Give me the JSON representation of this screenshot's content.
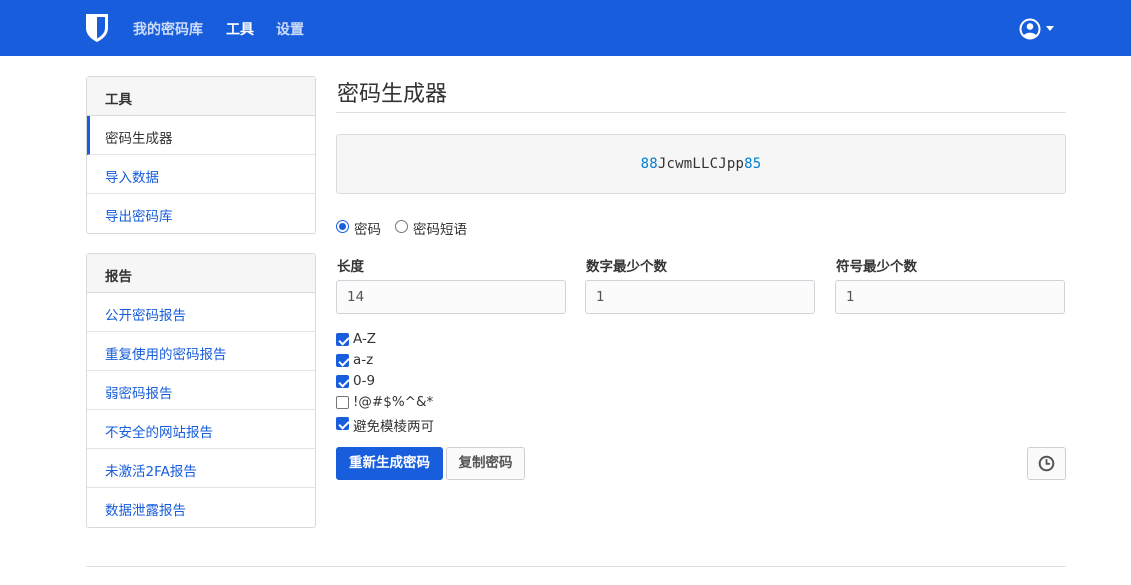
{
  "nav": {
    "links": [
      {
        "label": "我的密码库",
        "active": false
      },
      {
        "label": "工具",
        "active": true
      },
      {
        "label": "设置",
        "active": false
      }
    ],
    "brand_color": "#175ddc",
    "account_icon": "user-circle-icon"
  },
  "sidebar": {
    "tools": {
      "header": "工具",
      "items": [
        {
          "label": "密码生成器",
          "active": true
        },
        {
          "label": "导入数据",
          "active": false
        },
        {
          "label": "导出密码库",
          "active": false
        }
      ]
    },
    "reports": {
      "header": "报告",
      "items": [
        {
          "label": "公开密码报告"
        },
        {
          "label": "重复使用的密码报告"
        },
        {
          "label": "弱密码报告"
        },
        {
          "label": "不安全的网站报告"
        },
        {
          "label": "未激活2FA报告"
        },
        {
          "label": "数据泄露报告"
        }
      ]
    }
  },
  "main": {
    "title": "密码生成器",
    "password": {
      "value": "88JcwmLLCJpp85",
      "segments": [
        {
          "text": "88",
          "kind": "number"
        },
        {
          "text": "JcwmLLCJpp",
          "kind": "letter"
        },
        {
          "text": "85",
          "kind": "number"
        }
      ],
      "number_color": "#007fd2"
    },
    "type_options": [
      {
        "label": "密码",
        "checked": true
      },
      {
        "label": "密码短语",
        "checked": false
      }
    ],
    "fields": [
      {
        "label": "长度",
        "value": "14"
      },
      {
        "label": "数字最少个数",
        "value": "1"
      },
      {
        "label": "符号最少个数",
        "value": "1"
      }
    ],
    "checkboxes": [
      {
        "label": "A-Z",
        "checked": true
      },
      {
        "label": "a-z",
        "checked": true
      },
      {
        "label": "0-9",
        "checked": true
      },
      {
        "label": "!@#$%^&*",
        "checked": false
      },
      {
        "label": "避免模棱两可",
        "checked": true
      }
    ],
    "buttons": {
      "regenerate": "重新生成密码",
      "copy": "复制密码",
      "history_icon": "clock-history-icon"
    }
  }
}
